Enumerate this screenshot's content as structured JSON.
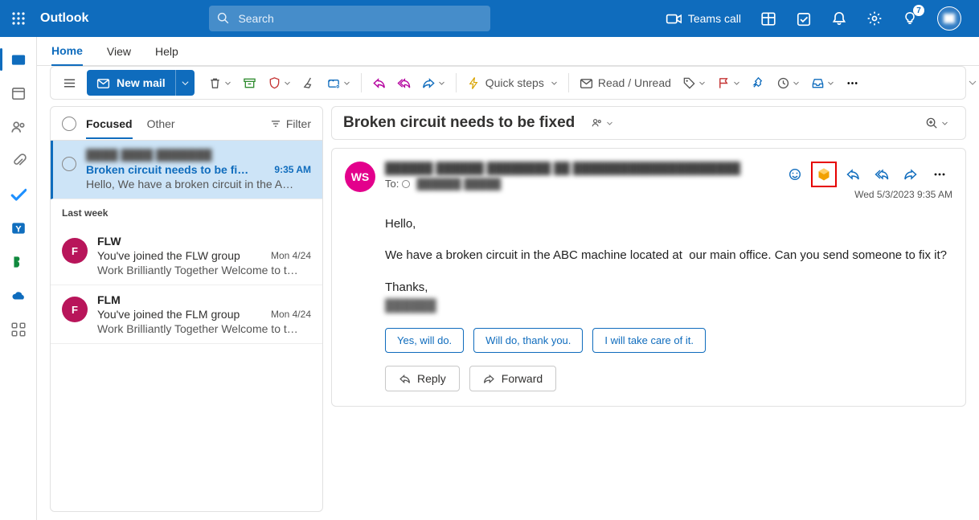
{
  "brand": "Outlook",
  "search_placeholder": "Search",
  "top_right": {
    "teams": "Teams call",
    "badge": "7"
  },
  "tabs": {
    "home": "Home",
    "view": "View",
    "help": "Help"
  },
  "ribbon": {
    "new_mail": "New mail",
    "quick_steps": "Quick steps",
    "read_unread": "Read / Unread"
  },
  "msglist": {
    "tab_focused": "Focused",
    "tab_other": "Other",
    "filter": "Filter",
    "group_lastweek": "Last week",
    "items": [
      {
        "sender": "████ ████ ███████",
        "subject": "Broken circuit needs to be fi…",
        "time": "9:35 AM",
        "preview": "Hello, We have a broken circuit in the A…"
      },
      {
        "sender": "FLW",
        "subject": "You've joined the FLW group",
        "time": "Mon 4/24",
        "preview": "Work Brilliantly Together Welcome to t…",
        "initial": "F"
      },
      {
        "sender": "FLM",
        "subject": "You've joined the FLM group",
        "time": "Mon 4/24",
        "preview": "Work Brilliantly Together Welcome to t…",
        "initial": "F"
      }
    ]
  },
  "reading": {
    "subject": "Broken circuit needs to be fixed",
    "avatar": "WS",
    "from": "██████ ██████ ████████ ██ █████████████████████",
    "to_label": "To:",
    "to": "██████ █████",
    "timestamp": "Wed 5/3/2023 9:35 AM",
    "body": {
      "p1": "Hello,",
      "p2": "We have a broken circuit in the ABC machine located at  our main office. Can you send someone to fix it?",
      "p3": "Thanks,",
      "sig": "██████"
    },
    "suggest": [
      "Yes, will do.",
      "Will do, thank you.",
      "I will take care of it."
    ],
    "reply": "Reply",
    "forward": "Forward"
  }
}
